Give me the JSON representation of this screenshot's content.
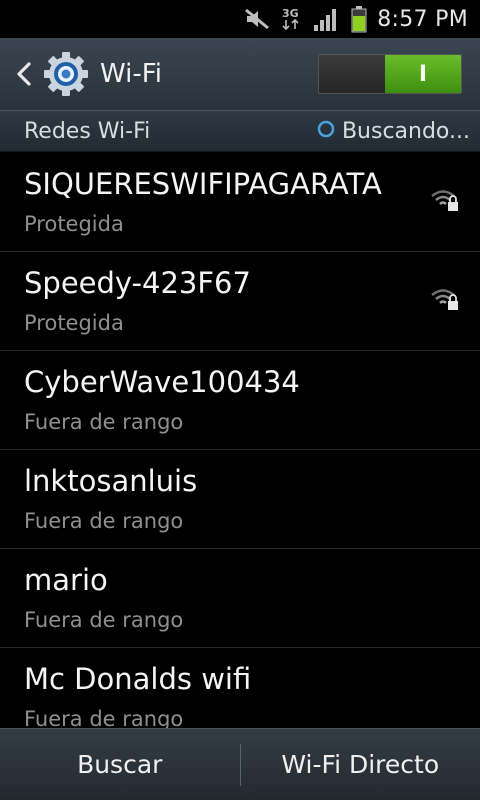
{
  "status_bar": {
    "time": "8:57 PM",
    "network_type": "3G",
    "icons": [
      "mute-icon",
      "data-3g-icon",
      "signal-icon",
      "battery-icon"
    ]
  },
  "action_bar": {
    "title": "Wi-Fi",
    "toggle_on_label": "I",
    "toggle_state": "on",
    "icons": [
      "back-arrow-icon",
      "gear-icon"
    ]
  },
  "section": {
    "label": "Redes Wi-Fi",
    "scanning_text": "Buscando..."
  },
  "networks": [
    {
      "ssid": "SIQUERESWIFIPAGARATA",
      "status": "Protegida",
      "secured": true
    },
    {
      "ssid": "Speedy-423F67",
      "status": "Protegida",
      "secured": true
    },
    {
      "ssid": "CyberWave100434",
      "status": "Fuera de rango",
      "secured": false
    },
    {
      "ssid": "lnktosanluis",
      "status": "Fuera de rango",
      "secured": false
    },
    {
      "ssid": "mario",
      "status": "Fuera de rango",
      "secured": false
    },
    {
      "ssid": "Mc Donalds wifi",
      "status": "Fuera de rango",
      "secured": false
    }
  ],
  "bottom_bar": {
    "scan_label": "Buscar",
    "wifi_direct_label": "Wi-Fi Directo"
  },
  "colors": {
    "accent_green": "#5aa81e",
    "bar_gray": "#2e3840",
    "secondary_text": "#8f8f8f"
  }
}
